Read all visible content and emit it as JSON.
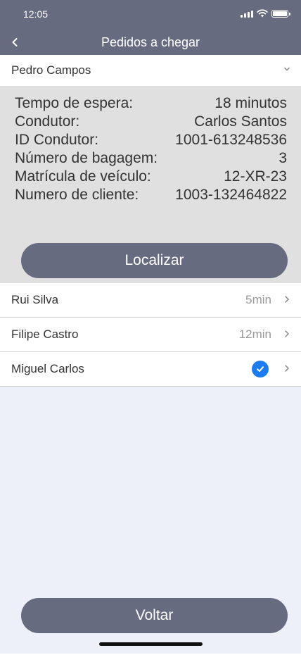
{
  "status_bar": {
    "time": "12:05"
  },
  "nav": {
    "title": "Pedidos a chegar",
    "back_icon": "chevron-left-icon"
  },
  "expanded": {
    "name": "Pedro Campos",
    "details": [
      {
        "label": "Tempo de espera:",
        "value": "18 minutos"
      },
      {
        "label": "Condutor:",
        "value": "Carlos Santos"
      },
      {
        "label": "ID Condutor:",
        "value": "1001-613248536"
      },
      {
        "label": "Número de bagagem:",
        "value": "3"
      },
      {
        "label": "Matrícula de veículo:",
        "value": "12-XR-23"
      },
      {
        "label": "Numero de cliente:",
        "value": "1003-132464822"
      }
    ],
    "locate_label": "Localizar"
  },
  "list": [
    {
      "name": "Rui Silva",
      "time": "5min",
      "checked": false
    },
    {
      "name": "Filipe Castro",
      "time": "12min",
      "checked": false
    },
    {
      "name": "Miguel Carlos",
      "time": "",
      "checked": true
    }
  ],
  "back_button_label": "Voltar",
  "colors": {
    "header": "#666b80",
    "details_bg": "#e0e0e0",
    "page_bg": "#edf0f8",
    "check": "#1a7cf0"
  }
}
